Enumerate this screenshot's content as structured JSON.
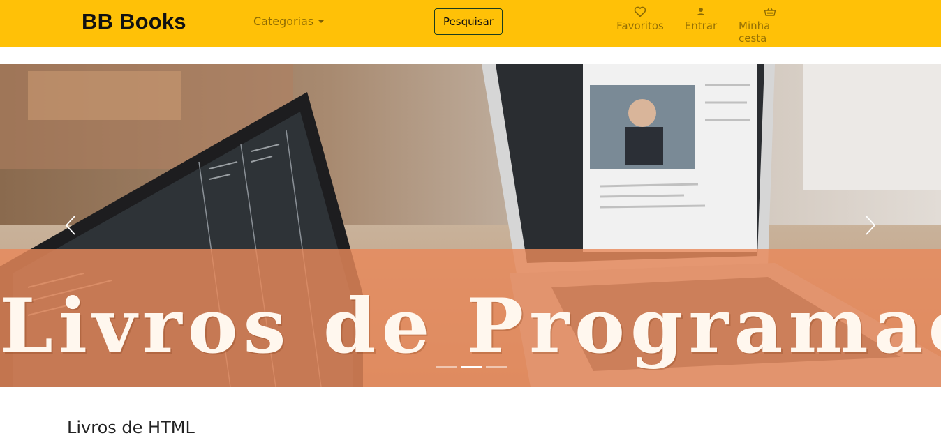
{
  "navbar": {
    "brand": "BB Books",
    "categories_label": "Categorias",
    "search_button": "Pesquisar",
    "items": [
      {
        "label": "Favoritos",
        "icon": "heart-icon"
      },
      {
        "label": "Entrar",
        "icon": "user-icon"
      },
      {
        "label": "Minha cesta",
        "icon": "basket-icon"
      }
    ],
    "background_color": "#ffc107"
  },
  "carousel": {
    "banner_text": "Livros de Programação",
    "prev_icon": "chevron-left-icon",
    "next_icon": "chevron-right-icon",
    "slide_count": 3,
    "active_slide": 2,
    "overlay_color": "#e8895a"
  },
  "section": {
    "title": "Livros de HTML"
  }
}
